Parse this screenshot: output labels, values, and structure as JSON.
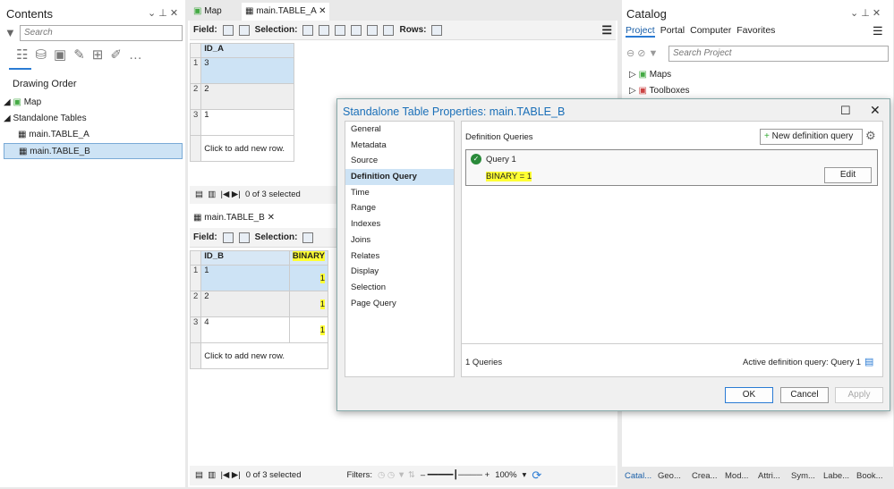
{
  "contents": {
    "title": "Contents",
    "search_placeholder": "Search",
    "drawing_order": "Drawing Order",
    "map": "Map",
    "standalone_tables": "Standalone Tables",
    "tables": [
      "main.TABLE_A",
      "main.TABLE_B"
    ]
  },
  "center": {
    "tabs": [
      "Map",
      "main.TABLE_A"
    ],
    "field_label": "Field:",
    "selection_label": "Selection:",
    "rows_label": "Rows:",
    "table_a": {
      "column": "ID_A",
      "rows": [
        "3",
        "2",
        "1"
      ],
      "add_row": "Click to add new row.",
      "status": "0 of 3 selected"
    },
    "table_b": {
      "tab": "main.TABLE_B",
      "columns": [
        "ID_B",
        "BINARY"
      ],
      "rows": [
        [
          "1",
          "1"
        ],
        [
          "2",
          "1"
        ],
        [
          "4",
          "1"
        ]
      ],
      "add_row": "Click to add new row."
    },
    "status": "0 of 3 selected",
    "filters_label": "Filters:",
    "zoom": "100%"
  },
  "catalog": {
    "title": "Catalog",
    "tabs": [
      "Project",
      "Portal",
      "Computer",
      "Favorites"
    ],
    "search_placeholder": "Search Project",
    "items": [
      "Maps",
      "Toolboxes"
    ],
    "bottom_tabs": [
      "Catal...",
      "Geo...",
      "Crea...",
      "Mod...",
      "Attri...",
      "Sym...",
      "Labe...",
      "Book..."
    ]
  },
  "dialog": {
    "title": "Standalone Table Properties: main.TABLE_B",
    "nav": [
      "General",
      "Metadata",
      "Source",
      "Definition Query",
      "Time",
      "Range",
      "Indexes",
      "Joins",
      "Relates",
      "Display",
      "Selection",
      "Page Query"
    ],
    "section": "Definition Queries",
    "new_query": "New definition query",
    "query_name": "Query 1",
    "query_expr": "BINARY = 1",
    "edit": "Edit",
    "count": "1 Queries",
    "active": "Active definition query: Query 1",
    "ok": "OK",
    "cancel": "Cancel",
    "apply": "Apply"
  }
}
